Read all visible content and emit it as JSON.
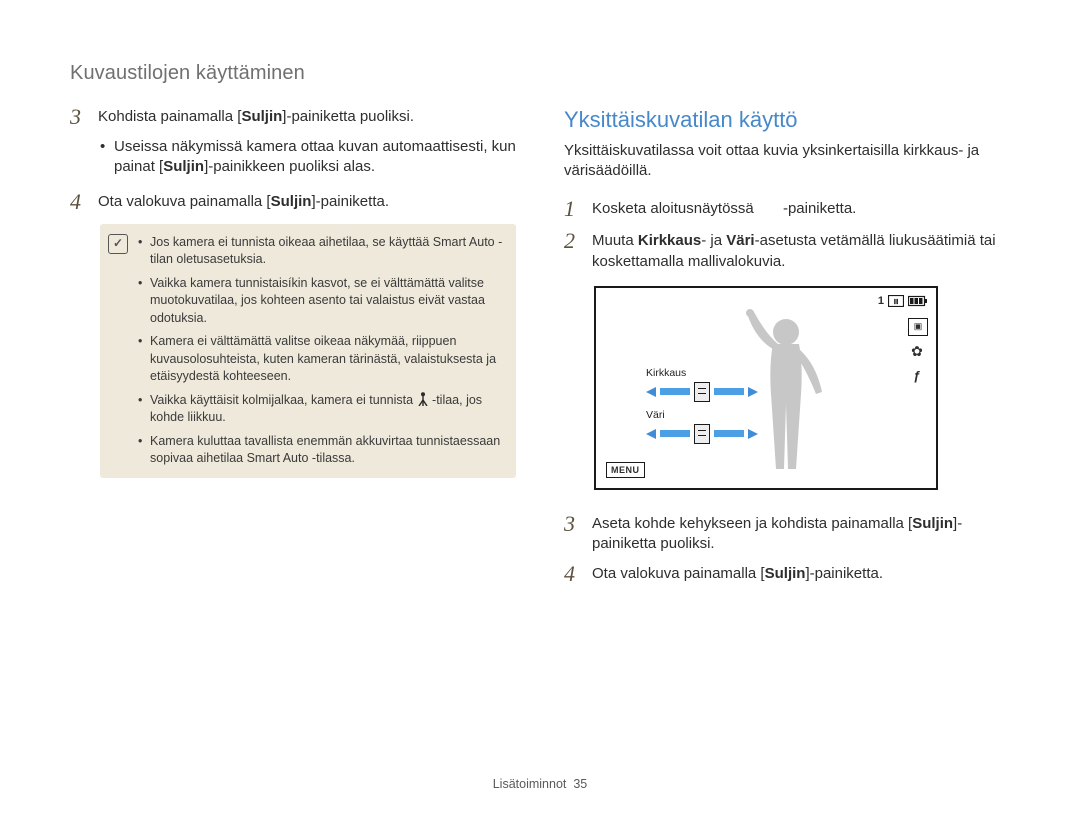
{
  "breadcrumb": "Kuvaustilojen käyttäminen",
  "left": {
    "step3": {
      "num": "3",
      "pre": "Kohdista painamalla [",
      "bold": "Suljin",
      "post": "]-painiketta puoliksi."
    },
    "step3_sub": {
      "pre": "Useissa näkymissä kamera ottaa kuvan automaattisesti, kun painat [",
      "bold": "Suljin",
      "post": "]-painikkeen puoliksi alas."
    },
    "step4": {
      "num": "4",
      "pre": "Ota valokuva painamalla [",
      "bold": "Suljin",
      "post": "]-painiketta."
    },
    "notes": [
      "Jos kamera ei tunnista oikeaa aihetilaa, se käyttää Smart Auto -tilan oletusasetuksia.",
      "Vaikka kamera tunnistaisíkin kasvot, se ei välttämättä valitse muotokuvatilaa, jos kohteen asento tai valaistus eivät vastaa odotuksia.",
      "Kamera ei välttämättä valitse oikeaa näkymää, riippuen kuvausolosuhteista, kuten kameran tärinästä, valaistuksesta ja etäisyydestä kohteeseen.",
      "Vaikka käyttäisit kolmijalkaa, kamera ei tunnista  -tilaa, jos kohde liikkuu.",
      "Kamera kuluttaa tavallista enemmän akkuvirtaa tunnistaessaan sopivaa aihetilaa Smart Auto -tilassa."
    ]
  },
  "right": {
    "title": "Yksittäiskuvatilan käyttö",
    "intro": "Yksittäiskuvatilassa voit ottaa kuvia yksinkertaisilla kirkkaus- ja värisäädöillä.",
    "step1": {
      "num": "1",
      "pre": "Kosketa aloitusnäytössä ",
      "post": " -painiketta."
    },
    "step2": {
      "num": "2",
      "pre": "Muuta ",
      "b1": "Kirkkaus",
      "mid1": "- ja ",
      "b2": "Väri",
      "post": "-asetusta vetämällä liukusäätimiä tai koskettamalla mallivalokuvia."
    },
    "cam": {
      "count": "1",
      "label_brightness": "Kirkkaus",
      "label_color": "Väri",
      "menu": "MENU"
    },
    "step3": {
      "num": "3",
      "pre": "Aseta kohde kehykseen ja kohdista painamalla [",
      "bold": "Suljin",
      "post": "]-painiketta puoliksi."
    },
    "step4": {
      "num": "4",
      "pre": "Ota valokuva painamalla [",
      "bold": "Suljin",
      "post": "]-painiketta."
    }
  },
  "footer": {
    "section": "Lisätoiminnot",
    "page": "35"
  }
}
